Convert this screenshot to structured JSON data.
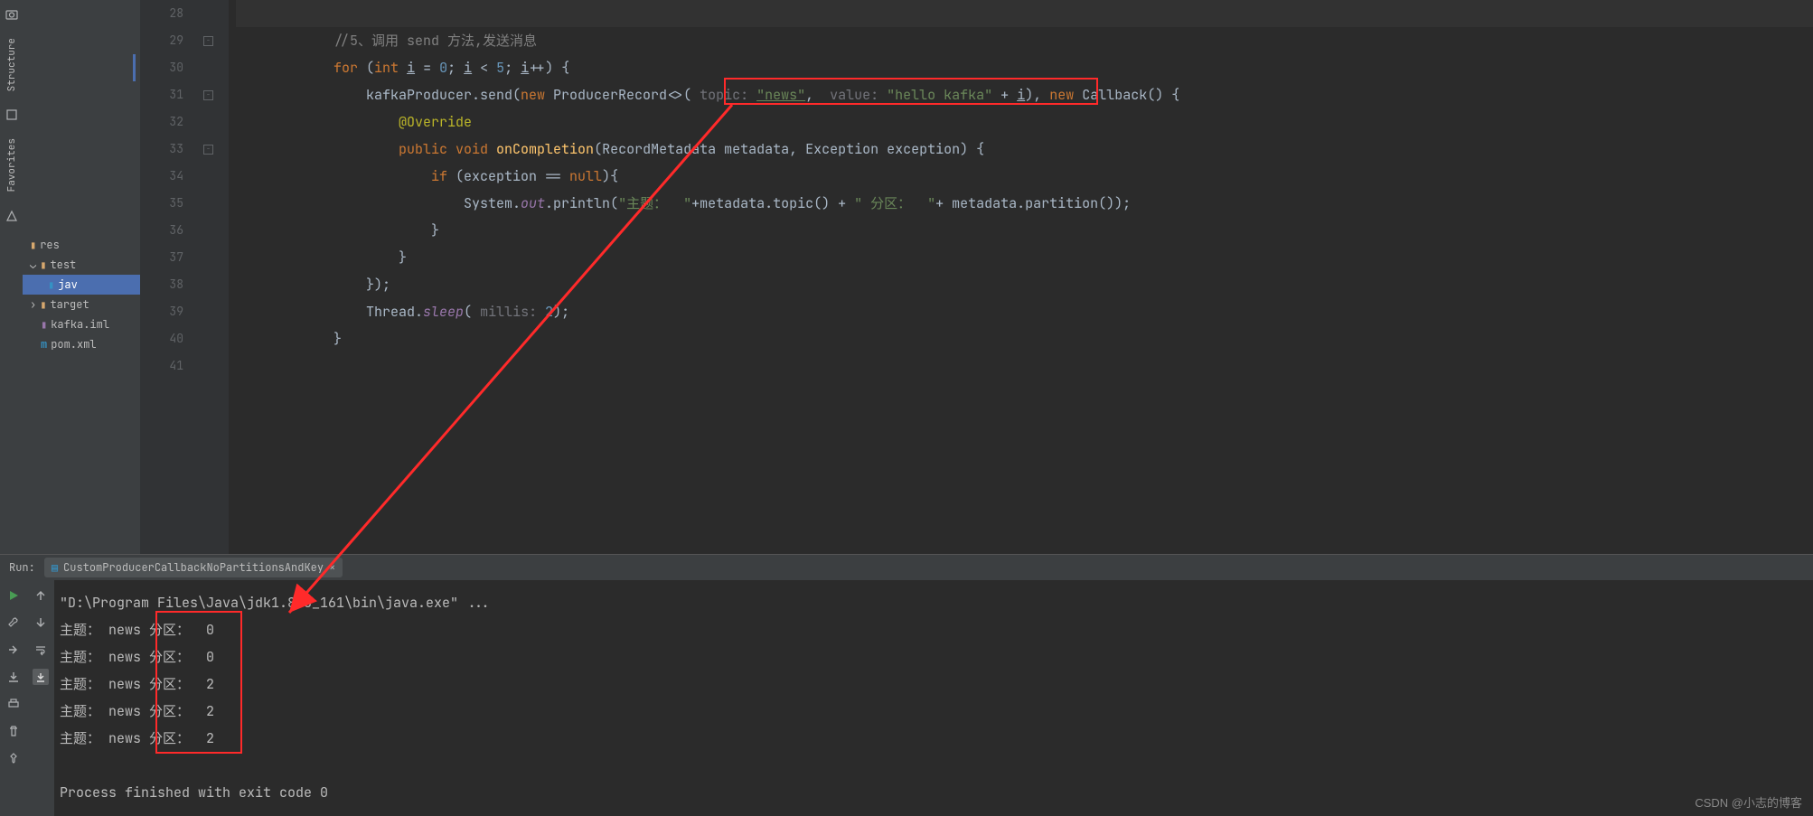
{
  "tree": {
    "res": "res",
    "test": "test",
    "jav": "jav",
    "target": "target",
    "kafka": "kafka.iml",
    "pom": "pom.xml"
  },
  "lineNumbers": [
    "28",
    "29",
    "30",
    "31",
    "32",
    "33",
    "34",
    "35",
    "36",
    "37",
    "38",
    "39",
    "40",
    "41"
  ],
  "code": {
    "l29_comment": "//5、调用 send 方法,发送消息",
    "l30_for": "for",
    "l30_int": "int",
    "l30_i": "i",
    "l30_eq": " = ",
    "l30_zero": "0",
    "l30_semi": "; ",
    "l30_i2": "i",
    "l30_lt": " < ",
    "l30_five": "5",
    "l30_semi2": "; ",
    "l30_i3": "i",
    "l30_pp": "++) {",
    "l31_send": "kafkaProducer.send(",
    "l31_new": "new",
    "l31_pr": " ProducerRecord<>( ",
    "l31_topic": "topic:",
    "l31_news": "\"news\"",
    "l31_comma": ",  ",
    "l31_value": "value:",
    "l31_hello": "\"hello kafka\"",
    "l31_plus": " + ",
    "l31_i": "i",
    "l31_close": "), ",
    "l31_new2": "new",
    "l31_cb": " Callback() {",
    "l32_override": "@Override",
    "l33_public": "public",
    "l33_void": " void",
    "l33_oncomp": " onCompletion",
    "l33_params": "(RecordMetadata metadata, Exception exception) {",
    "l34_if": "if",
    "l34_cond": " (exception == ",
    "l34_null": "null",
    "l34_brace": "){",
    "l35_sys": "System.",
    "l35_out": "out",
    "l35_pr": ".println(",
    "l35_s1": "\"主题：  \"",
    "l35_p1": "+metadata.topic() + ",
    "l35_s2": "\" 分区：  \"",
    "l35_p2": "+ metadata.partition());",
    "l36_brace": "}",
    "l37_brace": "}",
    "l38_close": "});",
    "l39_thread": "Thread.",
    "l39_sleep": "sleep",
    "l39_open": "( ",
    "l39_millis": "millis:",
    "l39_two": " 2",
    "l39_close": ");",
    "l40_brace": "}"
  },
  "run": {
    "header_label": "Run:",
    "tab_name": "CustomProducerCallbackNoPartitionsAndKey",
    "tab_close": "×"
  },
  "console": {
    "l0": "\"D:\\Program Files\\Java\\jdk1.8.0_161\\bin\\java.exe\" ...",
    "rows": [
      {
        "topic_lbl": "主题： ",
        "topic": "news",
        "part_lbl": " 分区：  ",
        "part": "0"
      },
      {
        "topic_lbl": "主题： ",
        "topic": "news",
        "part_lbl": " 分区：  ",
        "part": "0"
      },
      {
        "topic_lbl": "主题： ",
        "topic": "news",
        "part_lbl": " 分区：  ",
        "part": "2"
      },
      {
        "topic_lbl": "主题： ",
        "topic": "news",
        "part_lbl": " 分区：  ",
        "part": "2"
      },
      {
        "topic_lbl": "主题： ",
        "topic": "news",
        "part_lbl": " 分区：  ",
        "part": "2"
      }
    ],
    "exit": "Process finished with exit code 0"
  },
  "sidebar": {
    "structure": "Structure",
    "favorites": "Favorites"
  },
  "watermark": "CSDN @小志的博客"
}
